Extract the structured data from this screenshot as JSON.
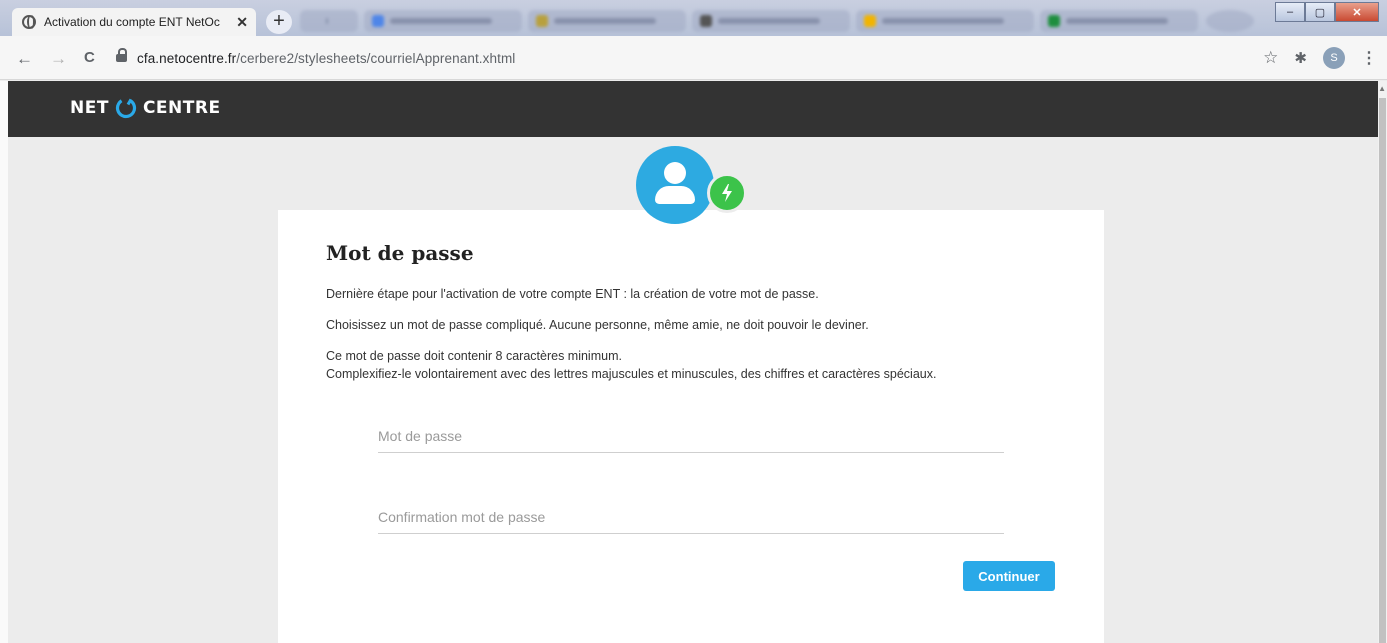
{
  "browser": {
    "active_tab_title": "Activation du compte ENT NetOc",
    "tab_close": "✕",
    "new_tab": "+",
    "url_host": "cfa.netocentre.fr",
    "url_path": "/cerbere2/stylesheets/courrielApprenant.xhtml",
    "profile_initial": "S",
    "window_buttons": {
      "minimize": "–",
      "maximize": "▢",
      "close": "✕"
    },
    "icons": {
      "back": "←",
      "forward": "→",
      "reload": "C",
      "bookmark": "☆",
      "extensions": "✱",
      "menu": "⋮"
    }
  },
  "site": {
    "logo_left": "NET",
    "logo_right": "CENTRE",
    "colors": {
      "header": "#333333",
      "accent": "#2aa9e8",
      "badge_green": "#3cc34a"
    }
  },
  "form": {
    "title": "Mot de passe",
    "intro": "Dernière étape pour l'activation de votre compte ENT : la création de votre mot de passe.",
    "advice": "Choisissez un mot de passe compliqué. Aucune personne, même amie, ne doit pouvoir le deviner.",
    "rule_line1": "Ce mot de passe doit contenir 8 caractères minimum.",
    "rule_line2": "Complexifiez-le volontairement avec des lettres majuscules et minuscules, des chiffres et caractères spéciaux.",
    "password_placeholder": "Mot de passe",
    "confirm_placeholder": "Confirmation mot de passe",
    "submit_label": "Continuer"
  }
}
